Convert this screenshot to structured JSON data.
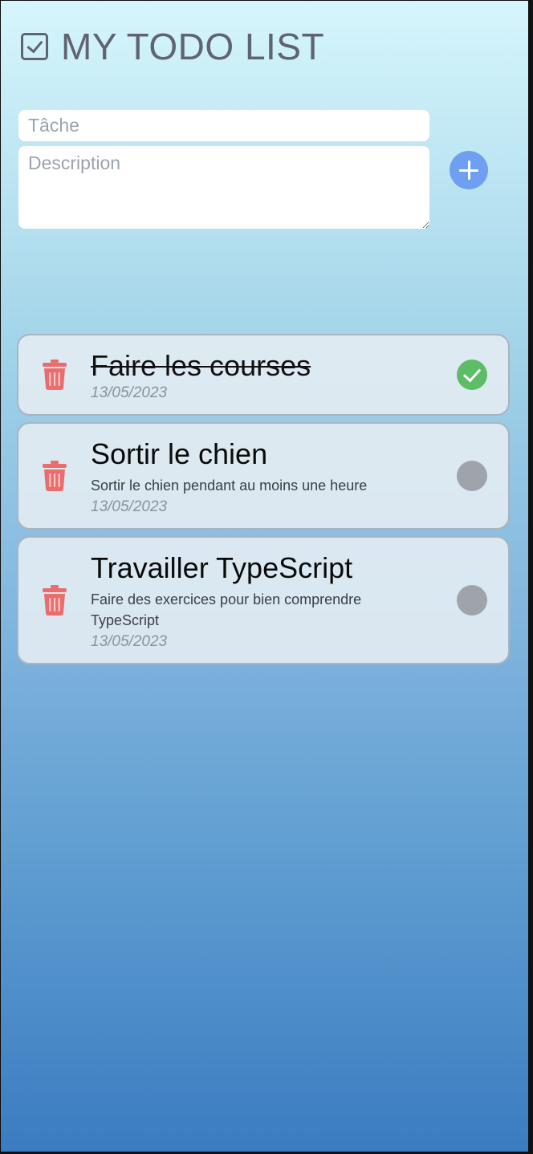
{
  "header": {
    "title": "MY TODO LIST",
    "icon": "check-box-icon"
  },
  "form": {
    "task_placeholder": "Tâche",
    "description_placeholder": "Description",
    "add_icon": "plus-icon"
  },
  "todos": [
    {
      "title": "Faire les courses",
      "description": "",
      "date": "13/05/2023",
      "done": true
    },
    {
      "title": "Sortir le chien",
      "description": "Sortir le chien pendant au moins une heure",
      "date": "13/05/2023",
      "done": false
    },
    {
      "title": "Travailler TypeScript",
      "description": "Faire des exercices pour bien comprendre TypeScript",
      "date": "13/05/2023",
      "done": false
    }
  ],
  "colors": {
    "accent": "#6f9ff0",
    "done": "#5cbd66",
    "pending": "#9fa3ab",
    "trash": "#ea6d6d"
  }
}
